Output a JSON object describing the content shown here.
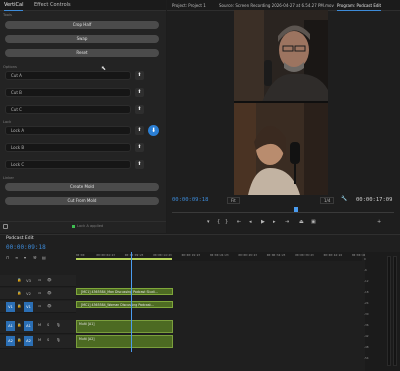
{
  "left_panel": {
    "tabs": [
      "VertiCal",
      "Effect Controls"
    ],
    "section_tools": "Tools",
    "buttons": {
      "crop": "Crop Half",
      "swap": "Swap",
      "reset": "Reset"
    },
    "section_options": "Options",
    "cuts": [
      "Cut A",
      "Cut B",
      "Cut C"
    ],
    "section_lock": "Lock",
    "locks": [
      "Lock A",
      "Lock B",
      "Lock C"
    ],
    "section_linker": "Linker",
    "create_mold": "Create Mold",
    "cut_from_mold": "Cut From Mold",
    "status": "Lock A applied",
    "arrow_up": "⬆",
    "arrow_down": "⬇"
  },
  "monitor": {
    "tabs": [
      "Project: Project 1",
      "Source: Screen Recording 2026-04-27 at 6.54.27 PM.mov",
      "Program: Podcast Edit"
    ],
    "timecode_current": "00:00:09:18",
    "fit": "Fit",
    "ratio": "1/4",
    "timecode_duration": "00:00:17:09"
  },
  "timeline": {
    "tab": "Podcast Edit",
    "timecode": "00:00:09:18",
    "ruler_ticks": [
      "00:00",
      "00:00:04:23",
      "00:00:09:23",
      "00:00:14:23",
      "00:00:19:23",
      "00:00:24:23",
      "00:00:29:23",
      "00:00:34:23",
      "00:00:39:23",
      "00:00:44:22",
      "00:00:49:22"
    ],
    "tracks": [
      {
        "id": "V3",
        "src": ""
      },
      {
        "id": "V2",
        "src": ""
      },
      {
        "id": "V1",
        "src": "V1"
      },
      {
        "id": "A1",
        "src": "A1"
      },
      {
        "id": "A2",
        "src": "A2"
      }
    ],
    "clips": {
      "v2": "[MC1] 4365584_Man Discussing Podcast Studi...",
      "v1": "[MC1] 4365584_Woman Discussing Podcast...",
      "a1": "Multi [A1]",
      "a2": "Multi [A2]"
    },
    "meter_scale": [
      "0",
      "-6",
      "-12",
      "-18",
      "-24",
      "-30",
      "-36",
      "-42",
      "-48",
      "-54"
    ]
  }
}
